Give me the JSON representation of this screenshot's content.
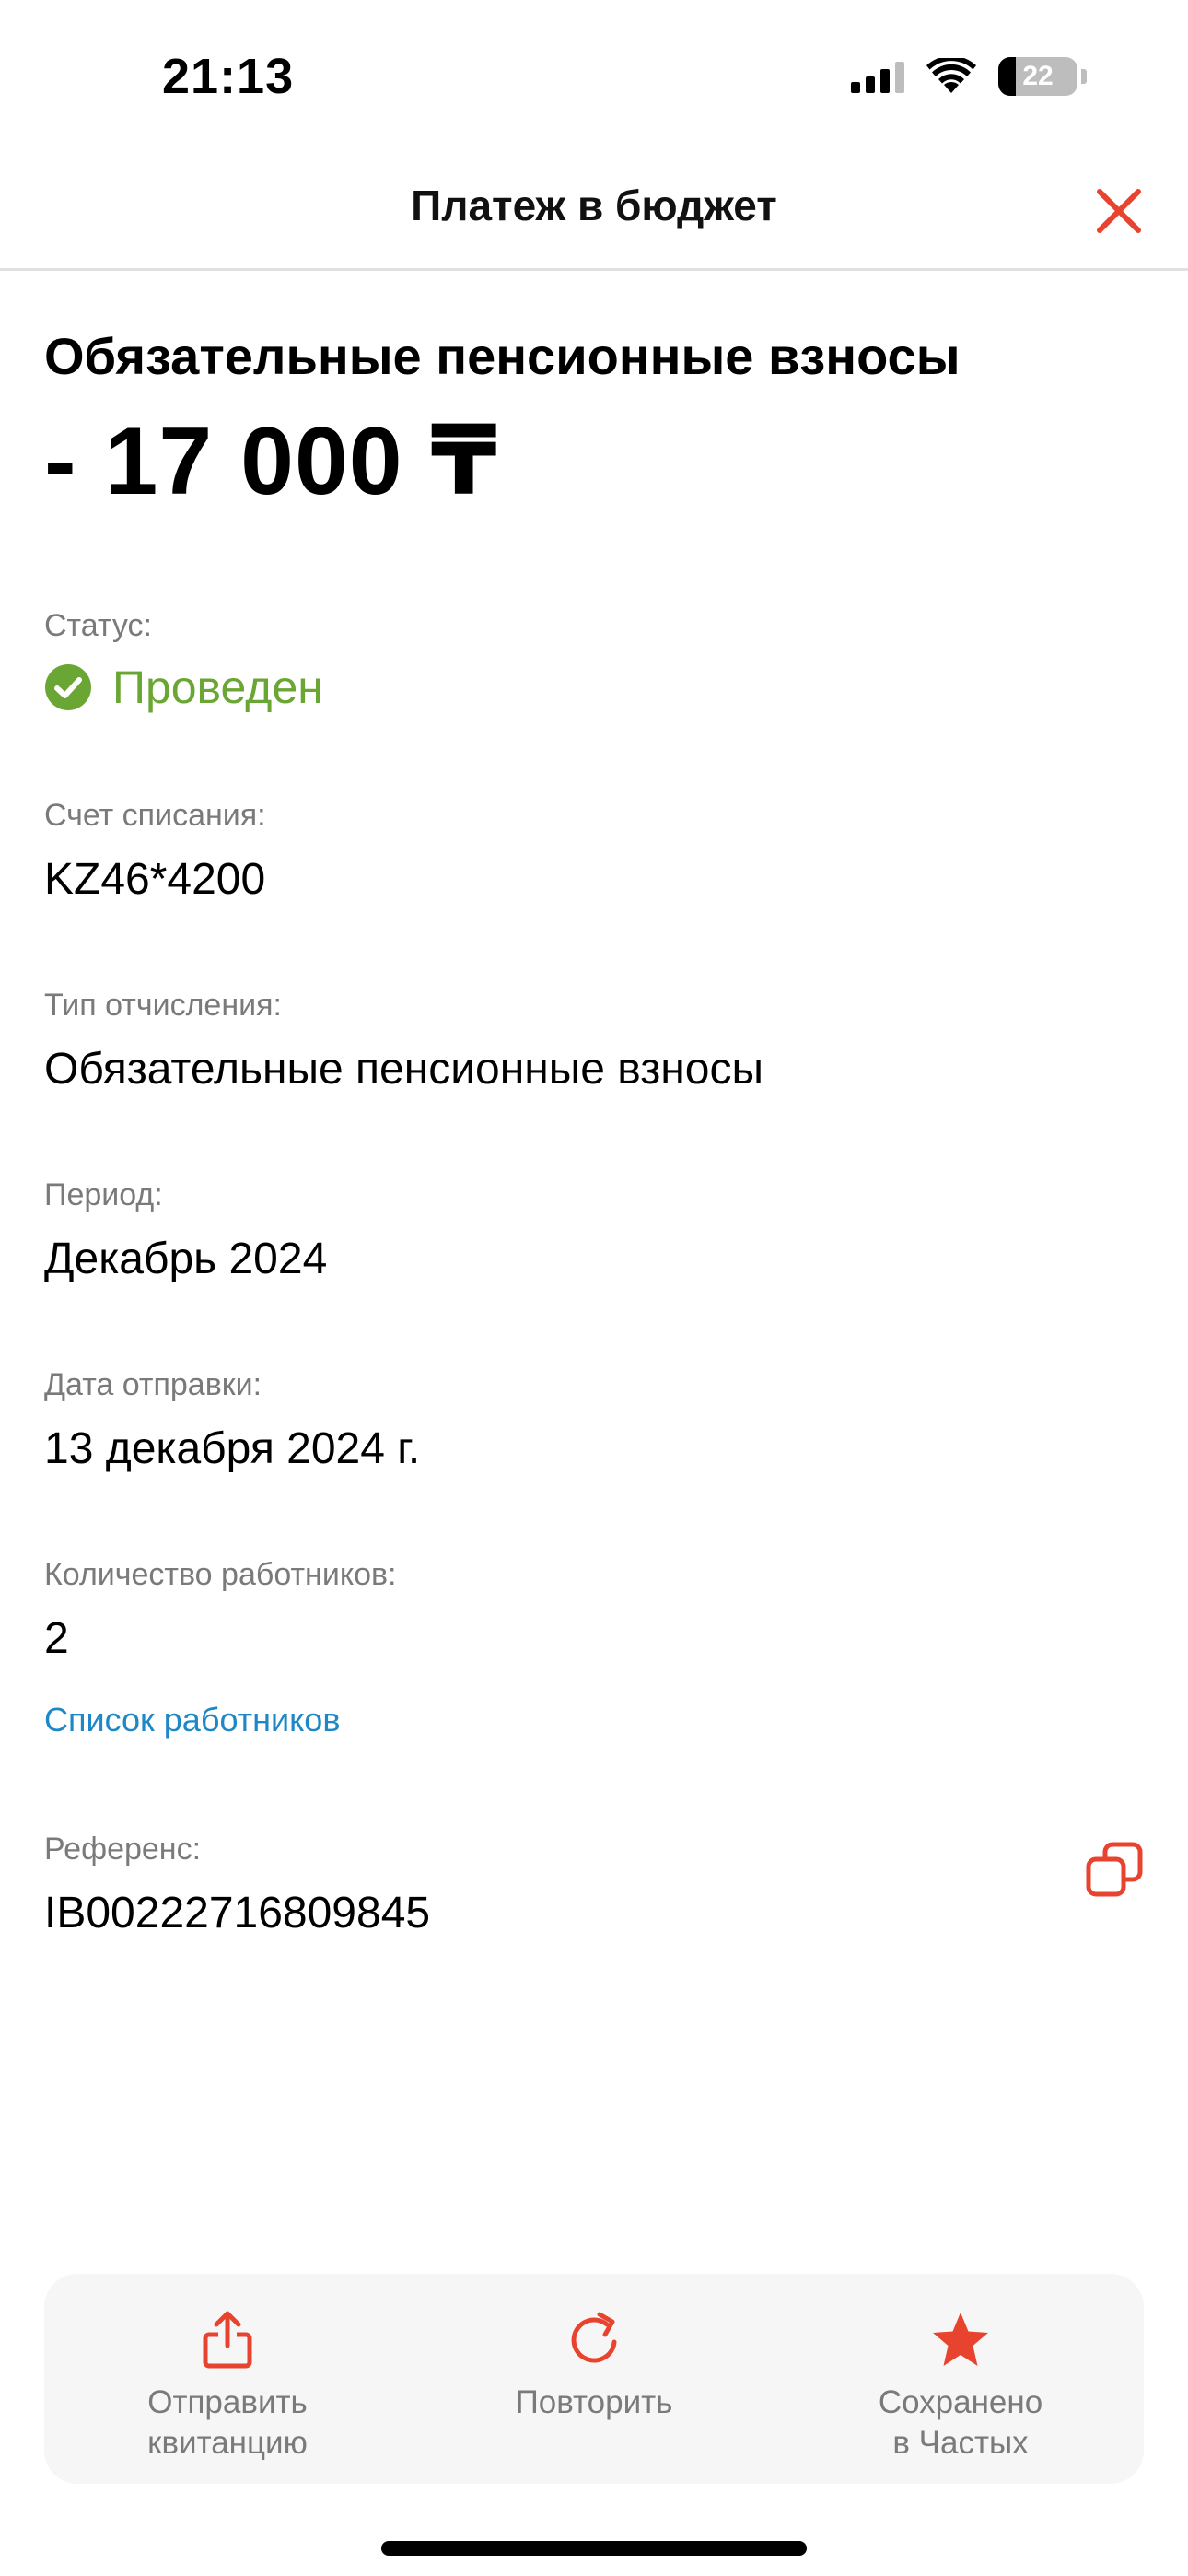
{
  "status_bar": {
    "time": "21:13",
    "battery_level": "22",
    "icons": [
      "cellular-signal-icon",
      "wifi-icon",
      "battery-icon"
    ]
  },
  "header": {
    "title": "Платеж в бюджет",
    "close_icon": "close-icon"
  },
  "payment": {
    "title": "Обязательные пенсионные взносы",
    "amount": "- 17 000 ₸"
  },
  "fields": {
    "status": {
      "label": "Статус:",
      "value": "Проведен",
      "icon": "check-circle-icon"
    },
    "account": {
      "label": "Счет списания:",
      "value": "KZ46*4200"
    },
    "type": {
      "label": "Тип отчисления:",
      "value": "Обязательные пенсионные взносы"
    },
    "period": {
      "label": "Период:",
      "value": "Декабрь 2024"
    },
    "date": {
      "label": "Дата отправки:",
      "value": "13 декабря 2024 г."
    },
    "employees": {
      "label": "Количество работников:",
      "value": "2",
      "link": "Список работников"
    },
    "reference": {
      "label": "Референс:",
      "value": "IB00222716809845",
      "icon": "copy-icon"
    }
  },
  "actions": [
    {
      "label": "Отправить\nквитанцию",
      "icon": "share-icon"
    },
    {
      "label": "Повторить",
      "icon": "repeat-icon"
    },
    {
      "label": "Сохранено\nв Частых",
      "icon": "star-icon"
    }
  ],
  "colors": {
    "accent": "#e8432e",
    "success": "#6aa633",
    "link": "#1e88c7",
    "label": "#7a7a7a"
  }
}
